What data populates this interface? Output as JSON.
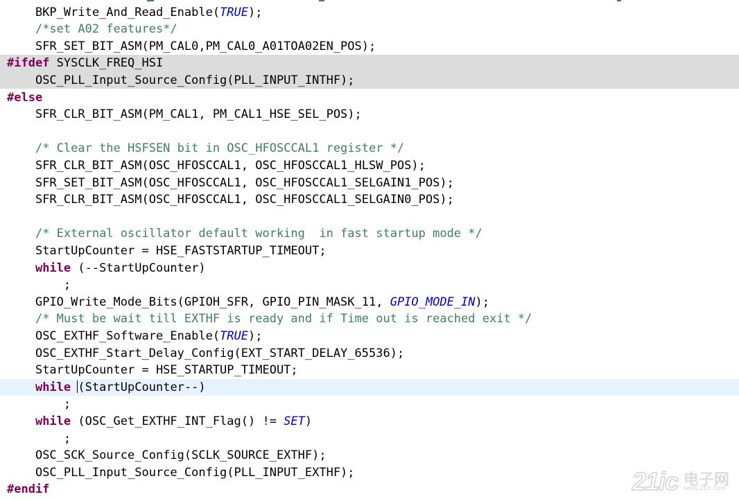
{
  "editor": {
    "lines": [
      {
        "indent": "    ",
        "parts": [
          {
            "t": "BKP_Write_And_Read_Enable(",
            "c": ""
          },
          {
            "t": "TRUE",
            "c": "it"
          },
          {
            "t": ");",
            "c": ""
          }
        ]
      },
      {
        "indent": "    ",
        "parts": [
          {
            "t": "/*set A02 features*/",
            "c": "cm"
          }
        ]
      },
      {
        "indent": "    ",
        "parts": [
          {
            "t": "SFR_SET_BIT_ASM(PM_CAL0,PM_CAL0_A01TOA02EN_POS);",
            "c": ""
          }
        ]
      },
      {
        "indent": "",
        "hl": "grey",
        "parts": [
          {
            "t": "#ifdef",
            "c": "pp"
          },
          {
            "t": " SYSCLK_FREQ_HSI",
            "c": ""
          }
        ]
      },
      {
        "indent": "    ",
        "hl": "grey",
        "parts": [
          {
            "t": "OSC_PLL_Input_Source_Config(PLL_INPUT_INTHF);",
            "c": ""
          }
        ]
      },
      {
        "indent": "",
        "parts": [
          {
            "t": "#else",
            "c": "pp"
          }
        ]
      },
      {
        "indent": "    ",
        "parts": [
          {
            "t": "SFR_CLR_BIT_ASM(PM_CAL1, PM_CAL1_HSE_SEL_POS);",
            "c": ""
          }
        ]
      },
      {
        "indent": "",
        "parts": []
      },
      {
        "indent": "    ",
        "parts": [
          {
            "t": "/* Clear the HSFSEN bit in OSC_HFOSCCAL1 register */",
            "c": "cm"
          }
        ]
      },
      {
        "indent": "    ",
        "parts": [
          {
            "t": "SFR_CLR_BIT_ASM(OSC_HFOSCCAL1, OSC_HFOSCCAL1_HLSW_POS);",
            "c": ""
          }
        ]
      },
      {
        "indent": "    ",
        "parts": [
          {
            "t": "SFR_SET_BIT_ASM(OSC_HFOSCCAL1, OSC_HFOSCCAL1_SELGAIN1_POS);",
            "c": ""
          }
        ]
      },
      {
        "indent": "    ",
        "parts": [
          {
            "t": "SFR_CLR_BIT_ASM(OSC_HFOSCCAL1, OSC_HFOSCCAL1_SELGAIN0_POS);",
            "c": ""
          }
        ]
      },
      {
        "indent": "",
        "parts": []
      },
      {
        "indent": "    ",
        "parts": [
          {
            "t": "/* External oscillator default working  in fast startup mode */",
            "c": "cm"
          }
        ]
      },
      {
        "indent": "    ",
        "parts": [
          {
            "t": "StartUpCounter = HSE_FASTSTARTUP_TIMEOUT;",
            "c": ""
          }
        ]
      },
      {
        "indent": "    ",
        "parts": [
          {
            "t": "while",
            "c": "kw"
          },
          {
            "t": " (--StartUpCounter)",
            "c": ""
          }
        ]
      },
      {
        "indent": "        ",
        "parts": [
          {
            "t": ";",
            "c": ""
          }
        ]
      },
      {
        "indent": "    ",
        "parts": [
          {
            "t": "GPIO_Write_Mode_Bits(GPIOH_SFR, GPIO_PIN_MASK_11, ",
            "c": ""
          },
          {
            "t": "GPIO_MODE_IN",
            "c": "it"
          },
          {
            "t": ");",
            "c": ""
          }
        ]
      },
      {
        "indent": "    ",
        "parts": [
          {
            "t": "/* Must be wait till EXTHF is ready and if Time out is reached exit */",
            "c": "cm"
          }
        ]
      },
      {
        "indent": "    ",
        "parts": [
          {
            "t": "OSC_EXTHF_Software_Enable(",
            "c": ""
          },
          {
            "t": "TRUE",
            "c": "it"
          },
          {
            "t": ");",
            "c": ""
          }
        ]
      },
      {
        "indent": "    ",
        "parts": [
          {
            "t": "OSC_EXTHF_Start_Delay_Config(EXT_START_DELAY_65536);",
            "c": ""
          }
        ]
      },
      {
        "indent": "    ",
        "parts": [
          {
            "t": "StartUpCounter = HSE_STARTUP_TIMEOUT;",
            "c": ""
          }
        ]
      },
      {
        "indent": "    ",
        "hl": "blue",
        "caret": true,
        "parts": [
          {
            "t": "while",
            "c": "kw"
          },
          {
            "t": " (StartUpCounter--)",
            "c": ""
          }
        ]
      },
      {
        "indent": "        ",
        "parts": [
          {
            "t": ";",
            "c": ""
          }
        ]
      },
      {
        "indent": "    ",
        "parts": [
          {
            "t": "while",
            "c": "kw"
          },
          {
            "t": " (OSC_Get_EXTHF_INT_Flag() != ",
            "c": ""
          },
          {
            "t": "SET",
            "c": "it"
          },
          {
            "t": ")",
            "c": ""
          }
        ]
      },
      {
        "indent": "        ",
        "parts": [
          {
            "t": ";",
            "c": ""
          }
        ]
      },
      {
        "indent": "    ",
        "parts": [
          {
            "t": "OSC_SCK_Source_Config(SCLK_SOURCE_EXTHF);",
            "c": ""
          }
        ]
      },
      {
        "indent": "    ",
        "parts": [
          {
            "t": "OSC_PLL_Input_Source_Config(PLL_INPUT_EXTHF);",
            "c": ""
          }
        ]
      },
      {
        "indent": "",
        "parts": [
          {
            "t": "#endif",
            "c": "pp"
          }
        ]
      }
    ]
  },
  "watermark": {
    "number": "21ic",
    "cn": "电子网",
    "url": "www.21ic.com"
  }
}
